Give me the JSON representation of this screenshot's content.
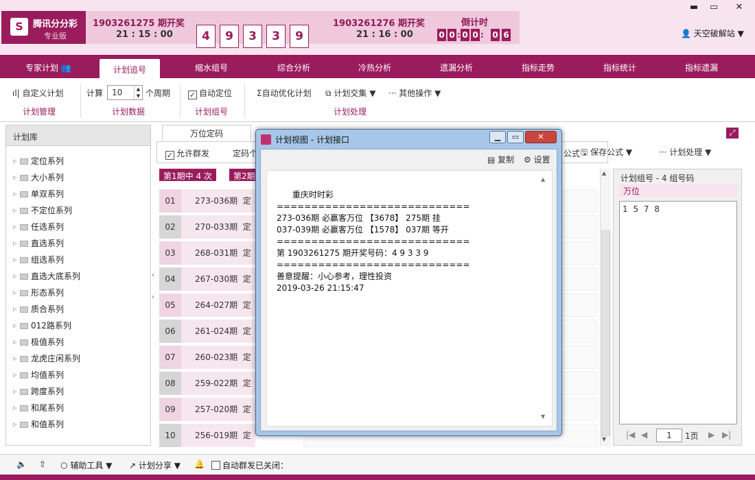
{
  "app": {
    "title": "腾讯分分彩",
    "edition": "专业版",
    "logo_glyph": "S"
  },
  "draw_last": {
    "period": "1903261275 期开奖",
    "time": "21 : 15 : 00",
    "balls": [
      "4",
      "9",
      "3",
      "3",
      "9"
    ]
  },
  "draw_next": {
    "period": "1903261276 期开奖",
    "time": "21 : 16 : 00",
    "countdown_label": "倒计时",
    "countdown": [
      "0",
      "0",
      "0",
      "0",
      "0",
      "6"
    ]
  },
  "window_controls": {
    "min": "▬",
    "max": "▭",
    "close": "✕"
  },
  "user": {
    "icon": "user-icon",
    "name": "天空破解站"
  },
  "nav": [
    "专家计划",
    "计划追号",
    "缩水组号",
    "综合分析",
    "冷热分析",
    "遗漏分析",
    "指标走势",
    "指标统计",
    "指标遗漏"
  ],
  "toolbar": {
    "custom_plan": "自定义计划",
    "calc": "计算",
    "calc_value": "10",
    "periods_suffix": "个周期",
    "auto_locate": "自动定位",
    "auto_optimize": "自动优化计划",
    "plan_intersect": "计划交集",
    "other_ops": "其他操作",
    "groups": [
      "计划管理",
      "计划数据",
      "计划组号",
      "计划处理"
    ]
  },
  "left_panel": {
    "title": "计划库",
    "items": [
      "定位系列",
      "大小系列",
      "单双系列",
      "不定位系列",
      "任选系列",
      "直选系列",
      "组选系列",
      "直选大底系列",
      "形态系列",
      "质合系列",
      "012路系列",
      "极值系列",
      "龙虎庄闲系列",
      "均值系列",
      "跨度系列",
      "和尾系列",
      "和值系列"
    ]
  },
  "middle": {
    "tab": "万位定码",
    "allow_group_send": "允许群发",
    "code_label": "定码个",
    "formula_label": "公式",
    "save_formula": "保存公式",
    "plan_process": "计划处理",
    "hit_badges": [
      "第1期中 4 次",
      "第2期"
    ],
    "rows": [
      {
        "num": "01",
        "period": "273-036期",
        "fix": "定"
      },
      {
        "num": "02",
        "period": "270-033期",
        "fix": "定"
      },
      {
        "num": "03",
        "period": "268-031期",
        "fix": "定"
      },
      {
        "num": "04",
        "period": "267-030期",
        "fix": "定"
      },
      {
        "num": "05",
        "period": "264-027期",
        "fix": "定"
      },
      {
        "num": "06",
        "period": "261-024期",
        "fix": "定"
      },
      {
        "num": "07",
        "period": "260-023期",
        "fix": "定"
      },
      {
        "num": "08",
        "period": "259-022期",
        "fix": "定"
      },
      {
        "num": "09",
        "period": "257-020期",
        "fix": "定"
      },
      {
        "num": "10",
        "period": "256-019期",
        "fix": "定"
      }
    ]
  },
  "right_panel": {
    "title": "计划组号 - 4 组号码",
    "position": "万位",
    "content": "1 5 7 8",
    "page_value": "1",
    "page_total": "1页"
  },
  "footer": {
    "tools": "辅助工具",
    "share": "计划分享",
    "auto_group": "自动群发已关闭："
  },
  "dialog": {
    "title": "计划视图 - 计划接口",
    "copy": "复制",
    "settings": "设置",
    "text": "重庆时时彩\n============================\n273-036期 必赢客万位 【3678】 275期 挂\n037-039期 必赢客万位 【1578】 037期 等开\n============================\n第 1903261275 期开奖号码：4 9 3 3 9\n============================\n善意提醒：小心参考，理性投资\n2019-03-26 21:15:47"
  }
}
